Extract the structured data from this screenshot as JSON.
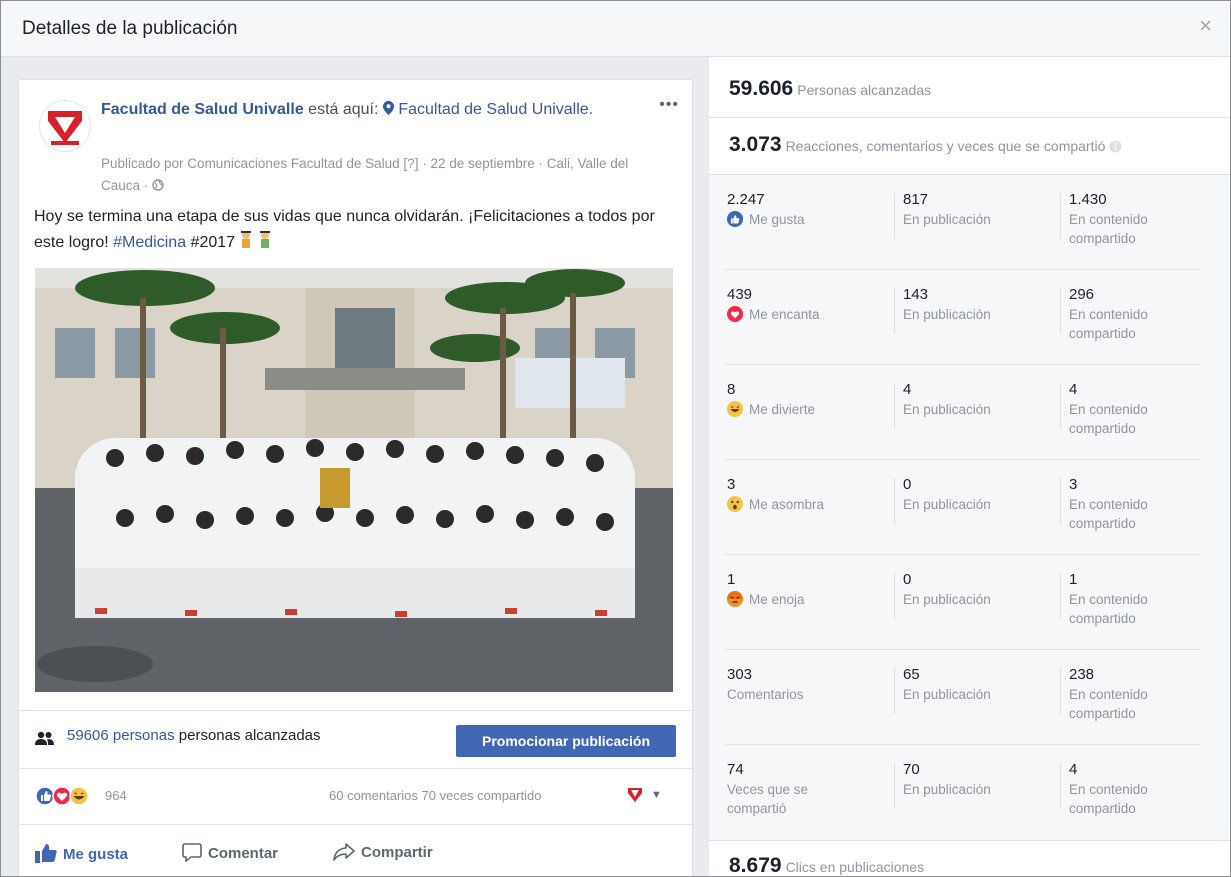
{
  "modal": {
    "title": "Detalles de la publicación",
    "close": "×"
  },
  "post": {
    "author": "Facultad de Salud Univalle",
    "is_here": " está aquí: ",
    "place": "Facultad de Salud Univalle.",
    "meta": "Publicado por Comunicaciones Facultad de Salud [?] · 22 de septiembre · Cali, Valle del Cauca · ",
    "text_main": "Hoy se termina una etapa de sus vidas que nunca olvidarán. ¡Felicitaciones a todos por este logro! ",
    "hashtag": "#Medicina",
    "text_tail": " #2017",
    "reach_count_link": "59606 personas",
    "reach_suffix": " personas alcanzadas",
    "promote_button": "Promocionar publicación",
    "reactions_count": "964",
    "comments_shares": "60 comentarios  70 veces compartido",
    "actions": {
      "like": "Me gusta",
      "comment": "Comentar",
      "share": "Compartir"
    }
  },
  "stats": {
    "reach": {
      "value": "59.606",
      "label": "Personas alcanzadas"
    },
    "engagement": {
      "value": "3.073",
      "label": "Reacciones, comentarios y veces que se compartió"
    },
    "clicks": {
      "value": "8.679",
      "label": "Clics en publicaciones"
    },
    "post_label": "En publicación",
    "shared_label": "En contenido compartido",
    "rows": [
      {
        "total": "2.247",
        "label": "Me gusta",
        "icon": "like",
        "on_post": "817",
        "on_shared": "1.430"
      },
      {
        "total": "439",
        "label": "Me encanta",
        "icon": "love",
        "on_post": "143",
        "on_shared": "296"
      },
      {
        "total": "8",
        "label": "Me divierte",
        "icon": "haha",
        "on_post": "4",
        "on_shared": "4"
      },
      {
        "total": "3",
        "label": "Me asombra",
        "icon": "wow",
        "on_post": "0",
        "on_shared": "3"
      },
      {
        "total": "1",
        "label": "Me enoja",
        "icon": "angry",
        "on_post": "0",
        "on_shared": "1"
      },
      {
        "total": "303",
        "label": "Comentarios",
        "icon": "",
        "on_post": "65",
        "on_shared": "238"
      },
      {
        "total": "74",
        "label": "Veces que se compartió",
        "icon": "",
        "on_post": "70",
        "on_shared": "4"
      }
    ]
  },
  "colors": {
    "fb_blue": "#4267b2",
    "link": "#365899",
    "muted": "#90949c",
    "love": "#f0284a",
    "haha": "#f7c244",
    "angry": "#e9710f"
  }
}
